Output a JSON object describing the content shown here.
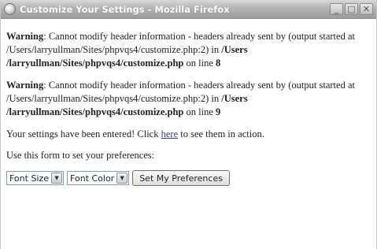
{
  "window": {
    "title": "Customize Your Settings - Mozilla Firefox",
    "minimize": "_",
    "maximize": "□",
    "close": "✕"
  },
  "warnings": [
    {
      "label": "Warning",
      "text": ": Cannot modify header information - headers already sent by (output started at /Users/larryullman/Sites/phpvqs4/customize.php:2) in ",
      "file": "/Users /larryullman/Sites/phpvqs4/customize.php",
      "line_text": " on line ",
      "line": "8"
    },
    {
      "label": "Warning",
      "text": ": Cannot modify header information - headers already sent by (output started at /Users/larryullman/Sites/phpvqs4/customize.php:2) in ",
      "file": "/Users /larryullman/Sites/phpvqs4/customize.php",
      "line_text": " on line ",
      "line": "9"
    }
  ],
  "confirmation": {
    "before": "Your settings have been entered! Click ",
    "link": "here",
    "after": " to see them in action."
  },
  "instructions": "Use this form to set your preferences:",
  "form": {
    "font_size_value": "Font Size",
    "font_color_value": "Font Color",
    "submit_label": "Set My Preferences"
  },
  "icons": {
    "app": "firefox-icon",
    "dropdown": "chevron-down-icon"
  }
}
